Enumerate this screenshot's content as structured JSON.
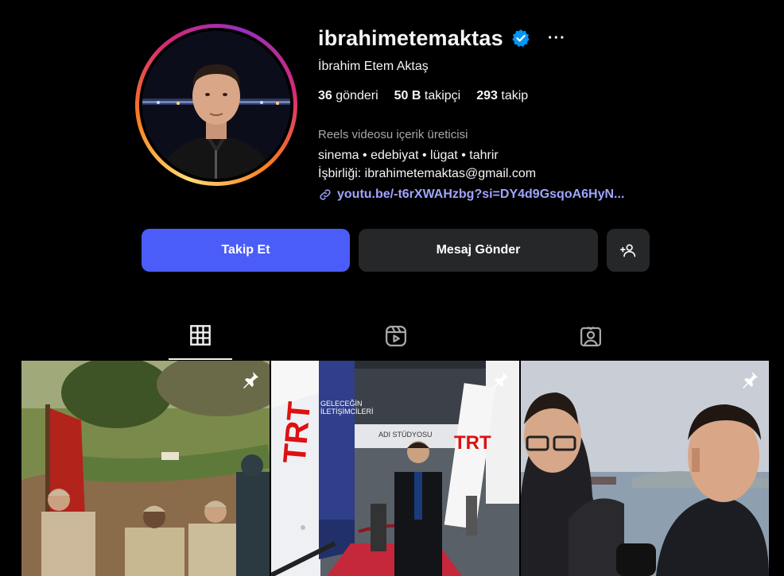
{
  "profile": {
    "username": "ibrahimetemaktas",
    "verified": true,
    "more_label": "···",
    "full_name": "İbrahim Etem Aktaş",
    "stats": {
      "posts_count": "36",
      "posts_label": "gönderi",
      "followers_count": "50 B",
      "followers_label": "takipçi",
      "following_count": "293",
      "following_label": "takip"
    },
    "category": "Reels videosu içerik üreticisi",
    "bio_line1": "sinema • edebiyat • lügat • tahrir",
    "bio_line2": "İşbirliği: ibrahimetemaktas@gmail.com",
    "link": "youtu.be/-t6rXWAHzbg?si=DY4d9GsqoA6HyN..."
  },
  "actions": {
    "follow_label": "Takip Et",
    "message_label": "Mesaj Gönder"
  },
  "tabs": [
    {
      "icon": "grid-icon",
      "active": true
    },
    {
      "icon": "reels-icon",
      "active": false
    },
    {
      "icon": "tagged-icon",
      "active": false
    }
  ],
  "posts": [
    {
      "pinned": true,
      "scene": "soldiers-with-flag-outdoors"
    },
    {
      "pinned": true,
      "scene": "man-in-suit-trt-event",
      "signage": [
        "TRT",
        "TRT",
        "GELECEĞİN İLETİŞİMCİLERİ",
        "ADI STÜDYOSU"
      ]
    },
    {
      "pinned": true,
      "scene": "two-men-by-the-sea"
    }
  ],
  "colors": {
    "follow_button": "#4a5df9",
    "secondary_button": "#262729",
    "verified_badge": "#0095f6",
    "link": "#a0a4ff",
    "muted_text": "#a8a8a8"
  }
}
